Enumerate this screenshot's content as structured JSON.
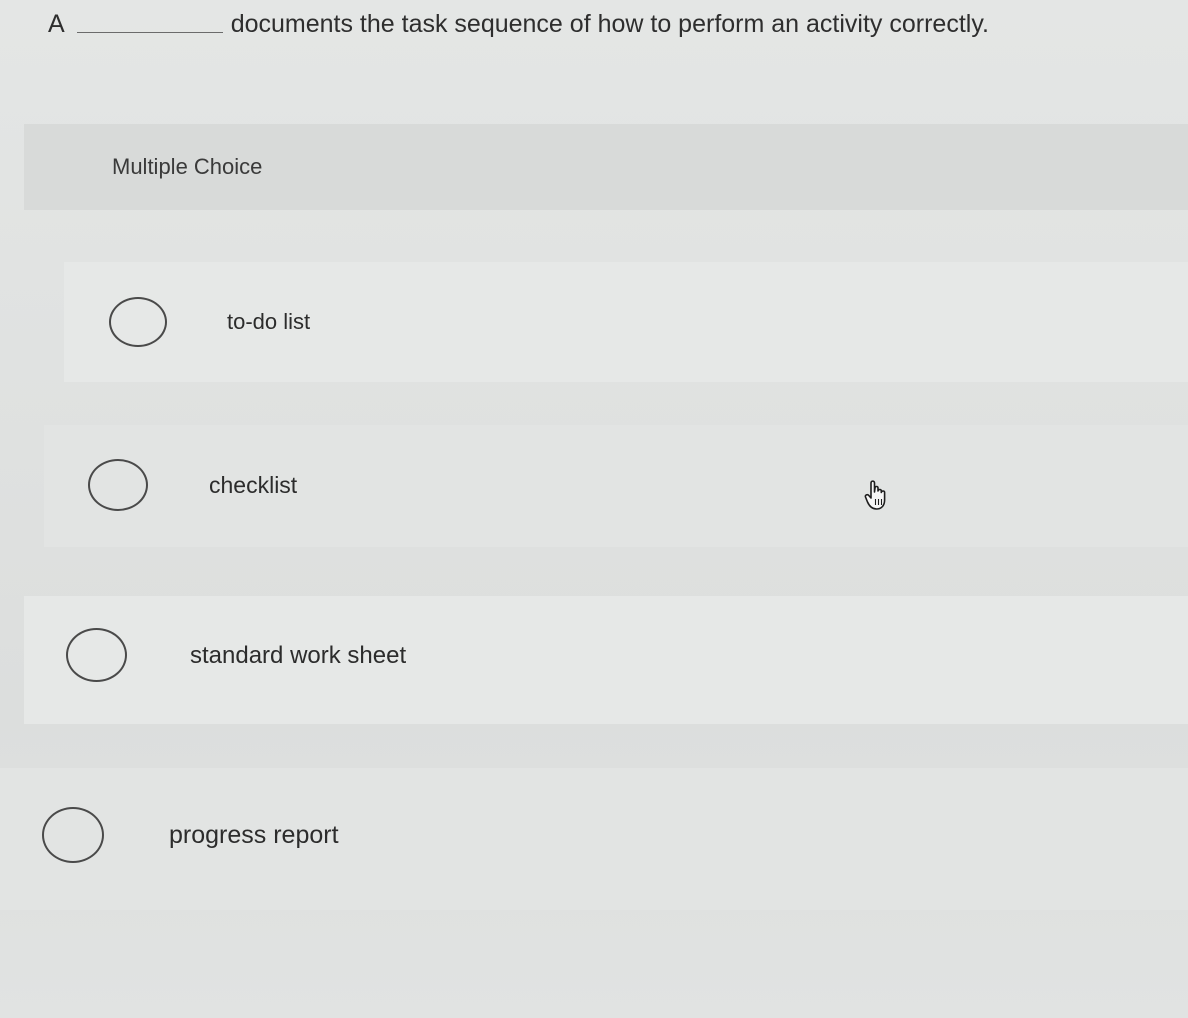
{
  "question": {
    "article": "A",
    "text": "documents the task sequence of how to perform an activity correctly."
  },
  "section": {
    "title": "Multiple Choice"
  },
  "options": [
    {
      "label": "to-do list",
      "selected": false
    },
    {
      "label": "checklist",
      "selected": false
    },
    {
      "label": "standard work sheet",
      "selected": false
    },
    {
      "label": "progress report",
      "selected": false
    }
  ],
  "cursor": {
    "icon": "hand-pointer-icon"
  }
}
